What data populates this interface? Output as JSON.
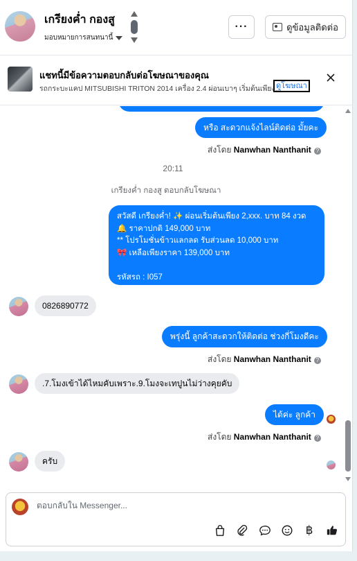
{
  "header": {
    "contact_name": "เกรียงค่ำ กองสู",
    "assign_label": "มอบหมายการสนทนานี้",
    "more_label": "···",
    "contact_button_label": "ดูข้อมูลติดต่อ"
  },
  "ad_banner": {
    "title": "แชทนี้มีข้อความตอบกลับต่อโฆษณาของคุณ",
    "description": "รถกระบะแคป MITSUBISHI TRITON 2014 เครื่อง 2.4 ผ่อนเบาๆ เริ่มต้นเพียง...",
    "link_label": "ดูโฆษณา"
  },
  "messages": {
    "m1_text": "หรือ สะดวกแจ้งไลน์ติดต่อ มั้ยคะ",
    "sentby_prefix": "ส่งโดย",
    "agent_name": "Nanwhan Nanthanit",
    "timestamp": "20:11",
    "ad_reply_note": "เกรียงค่ำ กองสู ตอบกลับโฆษณา",
    "promo_lines": [
      "สวัสดี เกรียงค่ำ! ✨  ผ่อนเริ่มต้นเพียง 2,xxx. บาท 84 งวด",
      "🔔 ราคาปกติ 149,000 บาท",
      "** โปรโมชั่นข้าวแลกลด รับส่วนลด 10,000 บาท",
      "🎀  เหลือเพียงราคา 139,000 บาท",
      "",
      "รหัสรถ : I057"
    ],
    "m3_text": "0826890772",
    "m4_text": "พรุ่งนี้ ลูกค้าสะดวกให้ติดต่อ ช่วงกี่โมงดีคะ",
    "m5_text": ".7.โมงเข้าได้ไหมคับเพราะ.9.โมงจะเทปูนไม่ว่างคุยคับ",
    "m6_text": "ได้ค่ะ  ลูกค้า",
    "m7_text": "ครับ"
  },
  "composer": {
    "placeholder": "ตอบกลับใน Messenger..."
  },
  "icons": {
    "tools": [
      "shopping-bag-icon",
      "paperclip-icon",
      "saved-reply-icon",
      "emoji-icon",
      "baht-icon",
      "thumbs-up-icon"
    ]
  }
}
